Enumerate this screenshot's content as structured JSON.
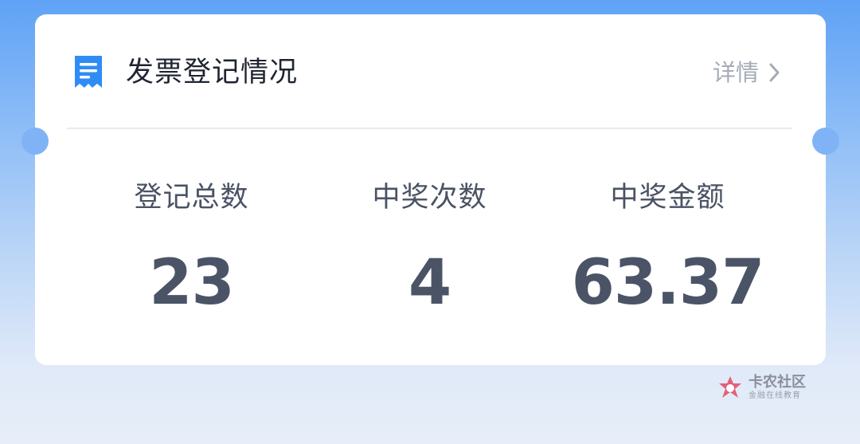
{
  "card": {
    "title": "发票登记情况",
    "details_label": "详情",
    "icon": "receipt-document-icon"
  },
  "stats": [
    {
      "label": "登记总数",
      "value": "23"
    },
    {
      "label": "中奖次数",
      "value": "4"
    },
    {
      "label": "中奖金额",
      "value": "63.37"
    }
  ],
  "watermark": {
    "name": "卡农社区",
    "tagline": "金融在线教育"
  },
  "colors": {
    "accent_blue": "#2f8cf6",
    "title_text": "#1f2430",
    "value_text": "#4b5467",
    "muted_text": "#a6abb6",
    "watermark_logo": "#e26079"
  }
}
